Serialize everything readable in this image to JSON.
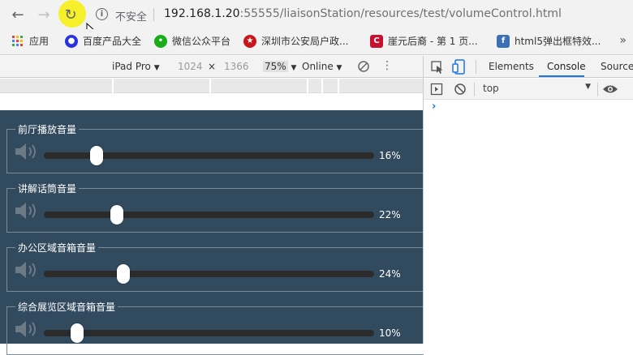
{
  "browser": {
    "back_glyph": "←",
    "forward_glyph": "→",
    "reload_glyph": "↻",
    "info_glyph": "i",
    "security_label": "不安全",
    "url_host": "192.168.1.20",
    "url_port": ":55555",
    "url_path": "/liaisonStation/resources/test/volumeControl.html"
  },
  "bookmarks": [
    {
      "label": "应用",
      "icon": "apps-grid-icon",
      "color": "#4285f4"
    },
    {
      "label": "百度产品大全",
      "icon": "baidu-paw-icon",
      "color": "#2932e1"
    },
    {
      "label": "微信公众平台",
      "icon": "wechat-icon",
      "color": "#1aad19"
    },
    {
      "label": "深圳市公安局户政...",
      "icon": "police-emblem-icon",
      "color": "#c8161d"
    },
    {
      "label": "崖元后裔 - 第 1 页...",
      "icon": "c-logo-icon",
      "color": "#c8102e"
    },
    {
      "label": "html5弹出框特效...",
      "icon": "f-logo-icon",
      "color": "#3b6fb6"
    }
  ],
  "bookmarks_overflow": "»",
  "device_toolbar": {
    "device": "iPad Pro",
    "width": "1024",
    "times": "×",
    "height": "1366",
    "zoom": "75%",
    "throttle": "Online",
    "more": "⋮"
  },
  "devtools": {
    "tabs": [
      "Elements",
      "Console",
      "Sources"
    ],
    "active_tab": "Console",
    "context": "top",
    "prompt": "›"
  },
  "volume_controls": [
    {
      "label": "前厅播放音量",
      "value": 16,
      "display": "16%"
    },
    {
      "label": "讲解话筒音量",
      "value": 22,
      "display": "22%"
    },
    {
      "label": "办公区域音箱音量",
      "value": 24,
      "display": "24%"
    },
    {
      "label": "综合展览区域音箱音量",
      "value": 10,
      "display": "10%"
    }
  ],
  "colors": {
    "panel_bg": "#324a5e",
    "track": "#2b2b2b",
    "thumb": "#ffffff",
    "border": "#7b8c99",
    "accent": "#1a73e8",
    "cursor_highlight": "#f6ef2c"
  }
}
